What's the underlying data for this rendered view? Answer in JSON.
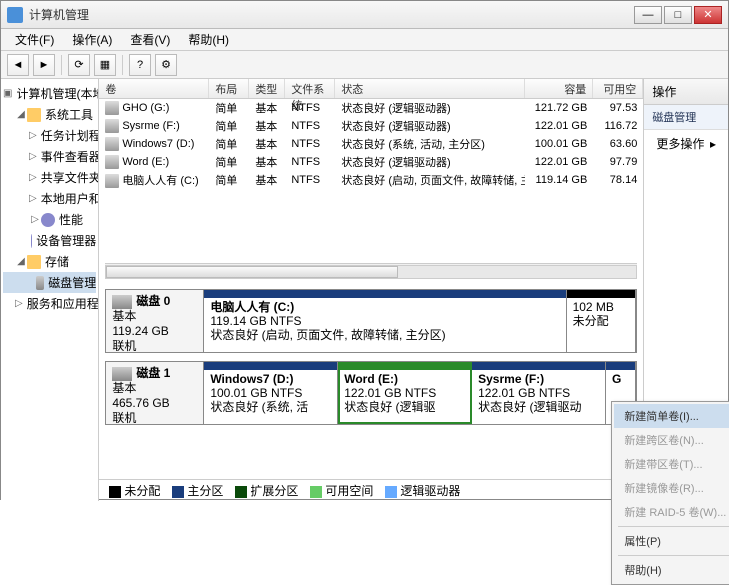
{
  "window": {
    "title": "计算机管理"
  },
  "menubar": {
    "file": "文件(F)",
    "action": "操作(A)",
    "view": "查看(V)",
    "help": "帮助(H)"
  },
  "tree": {
    "root": "计算机管理(本地)",
    "systools": "系统工具",
    "taskSched": "任务计划程序",
    "eventViewer": "事件查看器",
    "sharedFolders": "共享文件夹",
    "localUsers": "本地用户和组",
    "perf": "性能",
    "devMgr": "设备管理器",
    "storage": "存储",
    "diskMgmt": "磁盘管理",
    "services": "服务和应用程序"
  },
  "volHeader": {
    "volume": "卷",
    "layout": "布局",
    "type": "类型",
    "fs": "文件系统",
    "status": "状态",
    "capacity": "容量",
    "free": "可用空"
  },
  "volumes": [
    {
      "name": "GHO (G:)",
      "layout": "简单",
      "type": "基本",
      "fs": "NTFS",
      "status": "状态良好 (逻辑驱动器)",
      "cap": "121.72 GB",
      "free": "97.53"
    },
    {
      "name": "Sysrme (F:)",
      "layout": "简单",
      "type": "基本",
      "fs": "NTFS",
      "status": "状态良好 (逻辑驱动器)",
      "cap": "122.01 GB",
      "free": "116.72"
    },
    {
      "name": "Windows7 (D:)",
      "layout": "简单",
      "type": "基本",
      "fs": "NTFS",
      "status": "状态良好 (系统, 活动, 主分区)",
      "cap": "100.01 GB",
      "free": "63.60"
    },
    {
      "name": "Word (E:)",
      "layout": "简单",
      "type": "基本",
      "fs": "NTFS",
      "status": "状态良好 (逻辑驱动器)",
      "cap": "122.01 GB",
      "free": "97.79"
    },
    {
      "name": "电脑人人有 (C:)",
      "layout": "简单",
      "type": "基本",
      "fs": "NTFS",
      "status": "状态良好 (启动, 页面文件, 故障转储, 主分区)",
      "cap": "119.14 GB",
      "free": "78.14"
    }
  ],
  "disk0": {
    "title": "磁盘 0",
    "type": "基本",
    "size": "119.24 GB",
    "online": "联机",
    "p1": {
      "name": "电脑人人有  (C:)",
      "size": "119.14 GB NTFS",
      "status": "状态良好 (启动, 页面文件, 故障转储, 主分区)"
    },
    "p2": {
      "size": "102 MB",
      "status": "未分配"
    }
  },
  "disk1": {
    "title": "磁盘 1",
    "type": "基本",
    "size": "465.76 GB",
    "online": "联机",
    "p1": {
      "name": "Windows7  (D:)",
      "size": "100.01 GB NTFS",
      "status": "状态良好 (系统, 活"
    },
    "p2": {
      "name": "Word  (E:)",
      "size": "122.01 GB NTFS",
      "status": "状态良好 (逻辑驱"
    },
    "p3": {
      "name": "Sysrme  (F:)",
      "size": "122.01 GB NTFS",
      "status": "状态良好 (逻辑驱动"
    },
    "p4": {
      "name": "G"
    }
  },
  "legend": {
    "unalloc": "未分配",
    "primary": "主分区",
    "extended": "扩展分区",
    "free": "可用空间",
    "logical": "逻辑驱动器"
  },
  "actions": {
    "head": "操作",
    "diskMgmt": "磁盘管理",
    "more": "更多操作"
  },
  "ctx": {
    "newSimple": "新建简单卷(I)...",
    "newSpan": "新建跨区卷(N)...",
    "newStripe": "新建带区卷(T)...",
    "newMirror": "新建镜像卷(R)...",
    "newRaid5": "新建 RAID-5 卷(W)...",
    "props": "属性(P)",
    "help": "帮助(H)"
  }
}
